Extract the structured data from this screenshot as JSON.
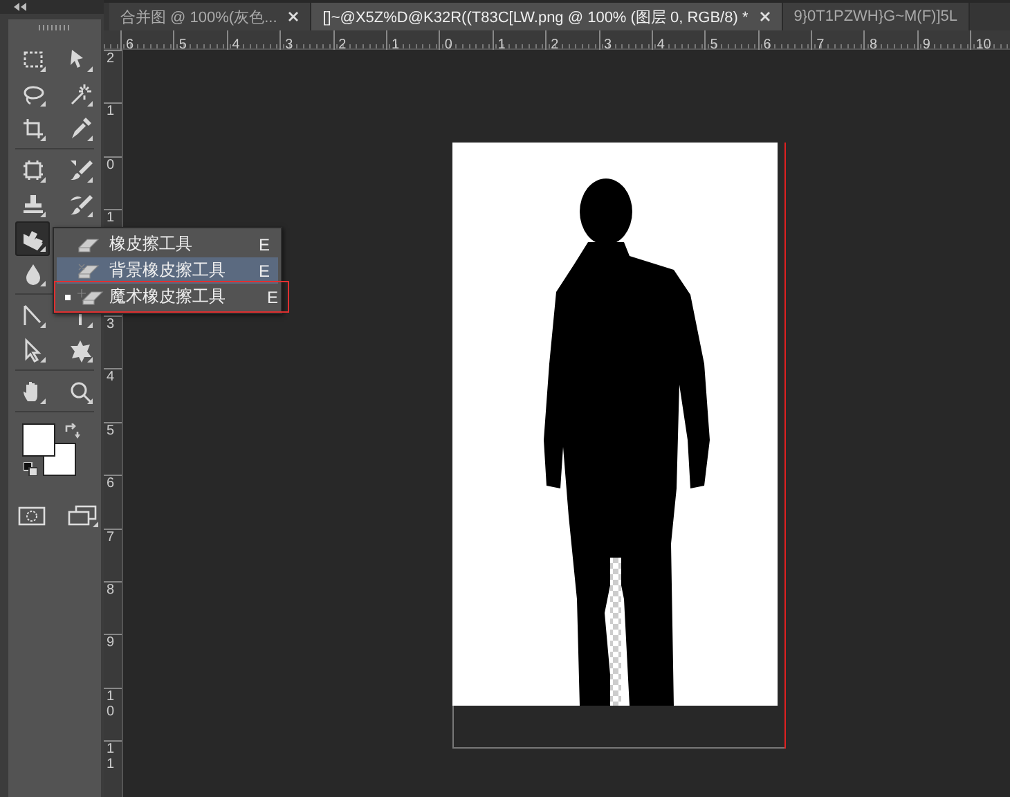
{
  "tabs": [
    {
      "label": "合并图 @ 100%(灰色...",
      "closable": true,
      "selected": false
    },
    {
      "label": "[]~@X5Z%D@K32R((T83C[LW.png @ 100% (图层 0, RGB/8) *",
      "closable": true,
      "selected": true
    },
    {
      "label": "9}0T1PZWH}G~M(F)]5L",
      "closable": false,
      "selected": false
    }
  ],
  "toolbar": {
    "groups": [
      {
        "rows": [
          [
            {
              "kind": "marquee",
              "selected": false
            },
            {
              "kind": "move",
              "selected": false
            }
          ],
          [
            {
              "kind": "lasso",
              "selected": false
            },
            {
              "kind": "wand",
              "selected": false
            }
          ],
          [
            {
              "kind": "crop",
              "selected": false
            },
            {
              "kind": "eyedropper",
              "selected": false
            }
          ]
        ]
      },
      {
        "rows": [
          [
            {
              "kind": "healing",
              "selected": false
            },
            {
              "kind": "brush",
              "selected": false
            }
          ],
          [
            {
              "kind": "stamp",
              "selected": false
            },
            {
              "kind": "history",
              "selected": false
            }
          ],
          [
            {
              "kind": "eraser",
              "selected": true
            }
          ],
          [
            {
              "kind": "drop",
              "selected": false
            }
          ]
        ]
      },
      {
        "rows": [
          [
            {
              "kind": "pen",
              "selected": false
            },
            {
              "kind": "type",
              "selected": false
            }
          ],
          [
            {
              "kind": "pointer",
              "selected": false
            },
            {
              "kind": "shape",
              "selected": false
            }
          ]
        ]
      },
      {
        "rows": [
          [
            {
              "kind": "hand",
              "selected": false
            },
            {
              "kind": "zoom",
              "selected": false
            }
          ]
        ]
      }
    ]
  },
  "flyout_menu": {
    "items": [
      {
        "kind": "eraser",
        "label": "橡皮擦工具",
        "shortcut": "E",
        "selected": false,
        "current": false
      },
      {
        "kind": "background-eraser",
        "label": "背景橡皮擦工具",
        "shortcut": "E",
        "selected": true,
        "current": false
      },
      {
        "kind": "magic-eraser",
        "label": "魔术橡皮擦工具",
        "shortcut": "E",
        "selected": false,
        "current": true,
        "annotated": true
      }
    ]
  },
  "rulers": {
    "horizontal": [
      "6",
      "5",
      "4",
      "3",
      "2",
      "1",
      "0",
      "1",
      "2",
      "3",
      "4",
      "5",
      "6",
      "7",
      "8",
      "9",
      "10"
    ],
    "vertical_above_menu": [
      "2",
      "1",
      "0",
      "1"
    ],
    "vertical_below_menu": [
      "3",
      "4",
      "5",
      "6",
      "7",
      "8",
      "9",
      "10",
      "11"
    ]
  }
}
